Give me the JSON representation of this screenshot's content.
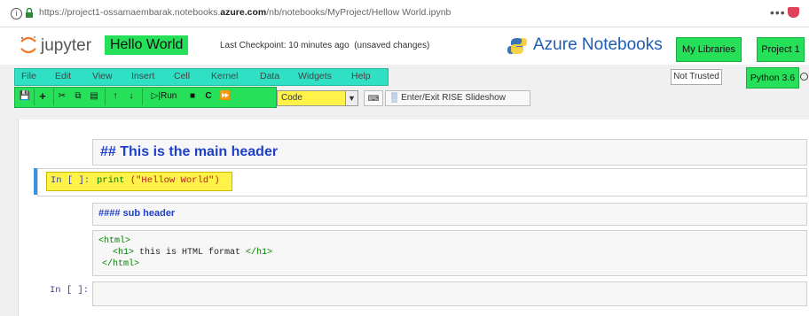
{
  "browser": {
    "url_prefix": "https://project1-ossamaembarak.notebooks.",
    "url_domain": "azure.com",
    "url_suffix": "/nb/notebooks/MyProject/Hellow World.ipynb",
    "more": "•••"
  },
  "header": {
    "app": "jupyter",
    "notebook_name": "Hello World",
    "checkpoint": "Last Checkpoint: 10 minutes ago",
    "unsaved": "(unsaved changes)",
    "service": "Azure Notebooks",
    "my_libraries": "My Libraries",
    "project": "Project 1"
  },
  "menu": [
    "File",
    "Edit",
    "View",
    "Insert",
    "Cell",
    "Kernel",
    "Data",
    "Widgets",
    "Help"
  ],
  "status": {
    "trust": "Not Trusted",
    "kernel": "Python 3.6"
  },
  "toolbar": {
    "run": "Run",
    "cell_type": "Code",
    "rise": "Enter/Exit RISE Slideshow"
  },
  "cells": {
    "md_header": "## This is the main header",
    "prompt": "In [ ]:",
    "code_print": "print",
    "code_arg": "(\"Hellow World\")",
    "md_sub": "#### sub header",
    "html_open": "<html>",
    "html_h1_open": "<h1>",
    "html_text": " this is HTML format ",
    "html_h1_close": "</h1>",
    "html_close": "</html>",
    "prompt_empty": "In [ ]:"
  },
  "colors": {
    "highlight_green": "#27e05a",
    "menu_teal": "#2fe0c4",
    "highlight_yellow": "#fff34a",
    "selected_blue": "#3792e0",
    "markdown_blue": "#1d3fc9"
  }
}
